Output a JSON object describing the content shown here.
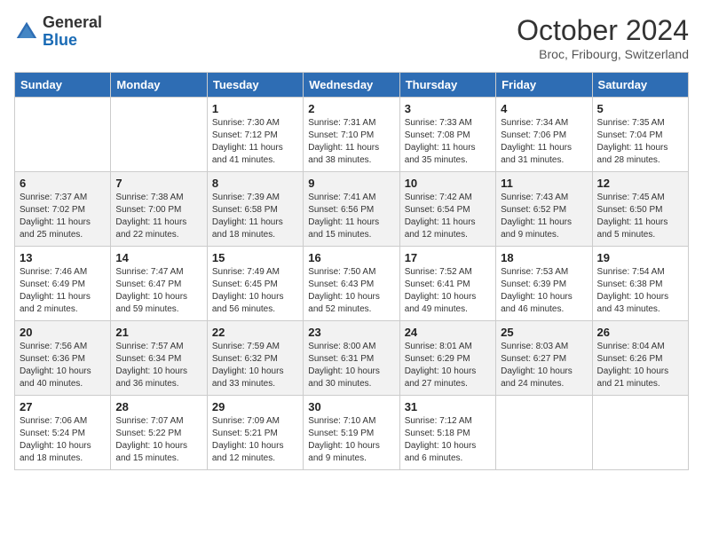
{
  "header": {
    "logo_general": "General",
    "logo_blue": "Blue",
    "month_title": "October 2024",
    "location": "Broc, Fribourg, Switzerland"
  },
  "days_of_week": [
    "Sunday",
    "Monday",
    "Tuesday",
    "Wednesday",
    "Thursday",
    "Friday",
    "Saturday"
  ],
  "weeks": [
    [
      {
        "day": "",
        "sunrise": "",
        "sunset": "",
        "daylight": ""
      },
      {
        "day": "",
        "sunrise": "",
        "sunset": "",
        "daylight": ""
      },
      {
        "day": "1",
        "sunrise": "Sunrise: 7:30 AM",
        "sunset": "Sunset: 7:12 PM",
        "daylight": "Daylight: 11 hours and 41 minutes."
      },
      {
        "day": "2",
        "sunrise": "Sunrise: 7:31 AM",
        "sunset": "Sunset: 7:10 PM",
        "daylight": "Daylight: 11 hours and 38 minutes."
      },
      {
        "day": "3",
        "sunrise": "Sunrise: 7:33 AM",
        "sunset": "Sunset: 7:08 PM",
        "daylight": "Daylight: 11 hours and 35 minutes."
      },
      {
        "day": "4",
        "sunrise": "Sunrise: 7:34 AM",
        "sunset": "Sunset: 7:06 PM",
        "daylight": "Daylight: 11 hours and 31 minutes."
      },
      {
        "day": "5",
        "sunrise": "Sunrise: 7:35 AM",
        "sunset": "Sunset: 7:04 PM",
        "daylight": "Daylight: 11 hours and 28 minutes."
      }
    ],
    [
      {
        "day": "6",
        "sunrise": "Sunrise: 7:37 AM",
        "sunset": "Sunset: 7:02 PM",
        "daylight": "Daylight: 11 hours and 25 minutes."
      },
      {
        "day": "7",
        "sunrise": "Sunrise: 7:38 AM",
        "sunset": "Sunset: 7:00 PM",
        "daylight": "Daylight: 11 hours and 22 minutes."
      },
      {
        "day": "8",
        "sunrise": "Sunrise: 7:39 AM",
        "sunset": "Sunset: 6:58 PM",
        "daylight": "Daylight: 11 hours and 18 minutes."
      },
      {
        "day": "9",
        "sunrise": "Sunrise: 7:41 AM",
        "sunset": "Sunset: 6:56 PM",
        "daylight": "Daylight: 11 hours and 15 minutes."
      },
      {
        "day": "10",
        "sunrise": "Sunrise: 7:42 AM",
        "sunset": "Sunset: 6:54 PM",
        "daylight": "Daylight: 11 hours and 12 minutes."
      },
      {
        "day": "11",
        "sunrise": "Sunrise: 7:43 AM",
        "sunset": "Sunset: 6:52 PM",
        "daylight": "Daylight: 11 hours and 9 minutes."
      },
      {
        "day": "12",
        "sunrise": "Sunrise: 7:45 AM",
        "sunset": "Sunset: 6:50 PM",
        "daylight": "Daylight: 11 hours and 5 minutes."
      }
    ],
    [
      {
        "day": "13",
        "sunrise": "Sunrise: 7:46 AM",
        "sunset": "Sunset: 6:49 PM",
        "daylight": "Daylight: 11 hours and 2 minutes."
      },
      {
        "day": "14",
        "sunrise": "Sunrise: 7:47 AM",
        "sunset": "Sunset: 6:47 PM",
        "daylight": "Daylight: 10 hours and 59 minutes."
      },
      {
        "day": "15",
        "sunrise": "Sunrise: 7:49 AM",
        "sunset": "Sunset: 6:45 PM",
        "daylight": "Daylight: 10 hours and 56 minutes."
      },
      {
        "day": "16",
        "sunrise": "Sunrise: 7:50 AM",
        "sunset": "Sunset: 6:43 PM",
        "daylight": "Daylight: 10 hours and 52 minutes."
      },
      {
        "day": "17",
        "sunrise": "Sunrise: 7:52 AM",
        "sunset": "Sunset: 6:41 PM",
        "daylight": "Daylight: 10 hours and 49 minutes."
      },
      {
        "day": "18",
        "sunrise": "Sunrise: 7:53 AM",
        "sunset": "Sunset: 6:39 PM",
        "daylight": "Daylight: 10 hours and 46 minutes."
      },
      {
        "day": "19",
        "sunrise": "Sunrise: 7:54 AM",
        "sunset": "Sunset: 6:38 PM",
        "daylight": "Daylight: 10 hours and 43 minutes."
      }
    ],
    [
      {
        "day": "20",
        "sunrise": "Sunrise: 7:56 AM",
        "sunset": "Sunset: 6:36 PM",
        "daylight": "Daylight: 10 hours and 40 minutes."
      },
      {
        "day": "21",
        "sunrise": "Sunrise: 7:57 AM",
        "sunset": "Sunset: 6:34 PM",
        "daylight": "Daylight: 10 hours and 36 minutes."
      },
      {
        "day": "22",
        "sunrise": "Sunrise: 7:59 AM",
        "sunset": "Sunset: 6:32 PM",
        "daylight": "Daylight: 10 hours and 33 minutes."
      },
      {
        "day": "23",
        "sunrise": "Sunrise: 8:00 AM",
        "sunset": "Sunset: 6:31 PM",
        "daylight": "Daylight: 10 hours and 30 minutes."
      },
      {
        "day": "24",
        "sunrise": "Sunrise: 8:01 AM",
        "sunset": "Sunset: 6:29 PM",
        "daylight": "Daylight: 10 hours and 27 minutes."
      },
      {
        "day": "25",
        "sunrise": "Sunrise: 8:03 AM",
        "sunset": "Sunset: 6:27 PM",
        "daylight": "Daylight: 10 hours and 24 minutes."
      },
      {
        "day": "26",
        "sunrise": "Sunrise: 8:04 AM",
        "sunset": "Sunset: 6:26 PM",
        "daylight": "Daylight: 10 hours and 21 minutes."
      }
    ],
    [
      {
        "day": "27",
        "sunrise": "Sunrise: 7:06 AM",
        "sunset": "Sunset: 5:24 PM",
        "daylight": "Daylight: 10 hours and 18 minutes."
      },
      {
        "day": "28",
        "sunrise": "Sunrise: 7:07 AM",
        "sunset": "Sunset: 5:22 PM",
        "daylight": "Daylight: 10 hours and 15 minutes."
      },
      {
        "day": "29",
        "sunrise": "Sunrise: 7:09 AM",
        "sunset": "Sunset: 5:21 PM",
        "daylight": "Daylight: 10 hours and 12 minutes."
      },
      {
        "day": "30",
        "sunrise": "Sunrise: 7:10 AM",
        "sunset": "Sunset: 5:19 PM",
        "daylight": "Daylight: 10 hours and 9 minutes."
      },
      {
        "day": "31",
        "sunrise": "Sunrise: 7:12 AM",
        "sunset": "Sunset: 5:18 PM",
        "daylight": "Daylight: 10 hours and 6 minutes."
      },
      {
        "day": "",
        "sunrise": "",
        "sunset": "",
        "daylight": ""
      },
      {
        "day": "",
        "sunrise": "",
        "sunset": "",
        "daylight": ""
      }
    ]
  ]
}
